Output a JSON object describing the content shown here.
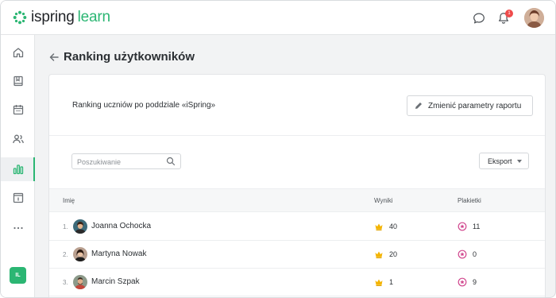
{
  "brand": {
    "part1": "ispring",
    "part2": "learn"
  },
  "header": {
    "notifications_count": "1",
    "icons": [
      "chat-icon",
      "bell-icon"
    ]
  },
  "sidebar": {
    "items": [
      {
        "icon": "home-icon"
      },
      {
        "icon": "book-icon"
      },
      {
        "icon": "calendar-icon"
      },
      {
        "icon": "users-icon"
      },
      {
        "icon": "reports-icon",
        "active": true
      },
      {
        "icon": "info-icon"
      },
      {
        "icon": "more-icon"
      }
    ],
    "user_initials": "IL"
  },
  "page": {
    "title": "Ranking użytkowników",
    "report_description": "Ranking uczniów po poddziale «iSpring»",
    "change_params_label": "Zmienić parametry raportu",
    "search_placeholder": "Poszukiwanie",
    "export_label": "Eksport"
  },
  "table": {
    "columns": {
      "name": "Imię",
      "score": "Wyniki",
      "badges": "Plakietki"
    },
    "rows": [
      {
        "rank": "1.",
        "name": "Joanna Ochocka",
        "score": "40",
        "badges": "11"
      },
      {
        "rank": "2.",
        "name": "Martyna Nowak",
        "score": "20",
        "badges": "0"
      },
      {
        "rank": "3.",
        "name": "Marcin Szpak",
        "score": "1",
        "badges": "9"
      }
    ]
  },
  "colors": {
    "brand_green": "#2bb673",
    "crown_gold": "#f4b400",
    "badge_pink": "#d1478e",
    "notification_red": "#ef4b4b"
  }
}
